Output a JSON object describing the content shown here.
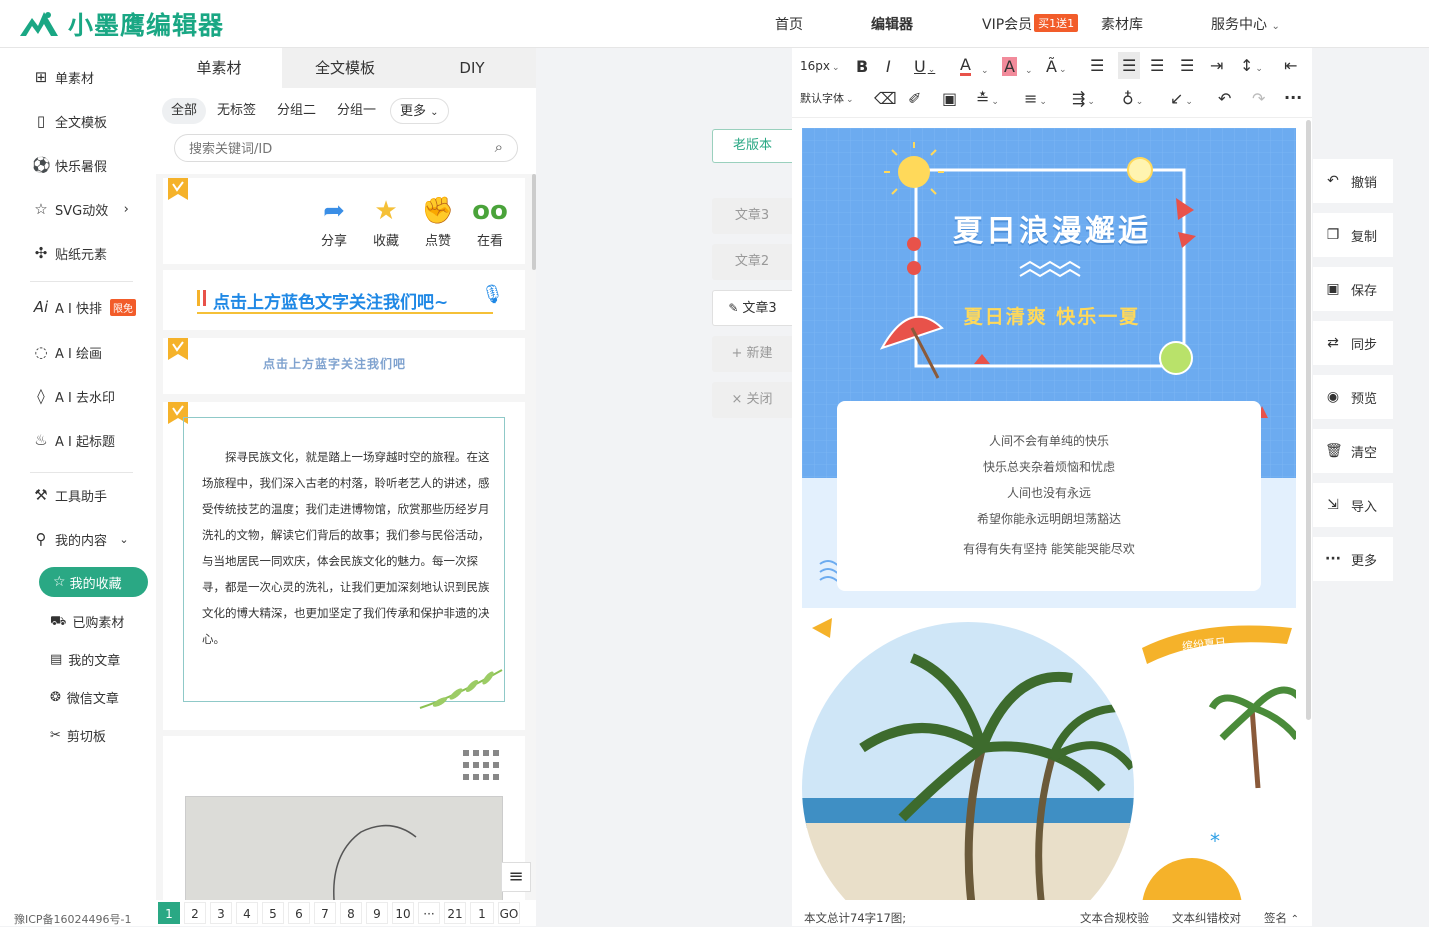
{
  "header": {
    "logo_text": "小墨鹰编辑器",
    "nav": {
      "home": "首页",
      "editor": "编辑器",
      "vip": "VIP会员",
      "vip_badge": "买1送1",
      "library": "素材库",
      "service": "服务中心"
    }
  },
  "sidebar": {
    "items": {
      "single": "单素材",
      "fulltext": "全文模板",
      "summer": "快乐暑假",
      "svg": "SVG动效",
      "sticker": "贴纸元素",
      "ai_layout": "A I 快排",
      "ai_layout_badge": "限免",
      "ai_draw": "A I 绘画",
      "ai_watermark": "A I 去水印",
      "ai_title": "A I 起标题",
      "tools": "工具助手",
      "my_content": "我的内容"
    },
    "sub_items": {
      "favorites": "我的收藏",
      "purchased": "已购素材",
      "articles": "我的文章",
      "wechat": "微信文章",
      "clipboard": "剪切板"
    },
    "icp": "豫ICP备16024496号-1"
  },
  "material_panel": {
    "tabs": [
      "单素材",
      "全文模板",
      "DIY"
    ],
    "filters": [
      "全部",
      "无标签",
      "分组二",
      "分组一",
      "更多"
    ],
    "search_placeholder": "搜索关键词/ID",
    "share_actions": [
      "分享",
      "收藏",
      "点赞",
      "在看"
    ],
    "banner_follow": "点击上方蓝色文字关注我们吧~",
    "banner_follow_small": "点击上方蓝字关注我们吧",
    "article": "探寻民族文化，就是踏上一场穿越时空的旅程。在这场旅程中，我们深入古老的村落，聆听老艺人的讲述，感受传统技艺的温度；我们走进博物馆，欣赏那些历经岁月洗礼的文物，解读它们背后的故事；我们参与民俗活动，与当地居民一同欢庆，体会民族文化的魅力。每一次探寻，都是一次心灵的洗礼，让我们更加深刻地认识到民族文化的博大精深，也更加坚定了我们传承和保护非遗的决心。",
    "pager": [
      "1",
      "2",
      "3",
      "4",
      "5",
      "6",
      "7",
      "8",
      "9",
      "10",
      "···",
      "21"
    ],
    "pager_input": "1",
    "pager_go": "GO"
  },
  "doc_tabs": {
    "old_version": "老版本",
    "tabs": [
      "文章3",
      "文章2",
      "文章3"
    ],
    "new": "新建",
    "close": "关闭"
  },
  "toolbar": {
    "font_size": "16px",
    "font_family": "默认字体"
  },
  "canvas": {
    "title": "夏日浪漫邂逅",
    "subtitle": "夏日清爽 快乐一夏",
    "poem": [
      "人间不会有单纯的快乐",
      "快乐总夹杂着烦恼和忧虑",
      "人间也没有永远",
      "希望你能永远明朗坦荡豁达",
      "有得有失有坚持 能笑能哭能尽欢"
    ],
    "tag": "缤纷夏日"
  },
  "status": {
    "count": "本文总计74字17图;",
    "compliance": "文本合规校验",
    "correction": "文本纠错校对",
    "signature": "签名"
  },
  "actions": [
    "撤销",
    "复制",
    "保存",
    "同步",
    "预览",
    "清空",
    "导入",
    "更多"
  ],
  "colors": {
    "brand": "#2aa884",
    "accent": "#f25c2a",
    "sky": "#6fb0f2"
  }
}
